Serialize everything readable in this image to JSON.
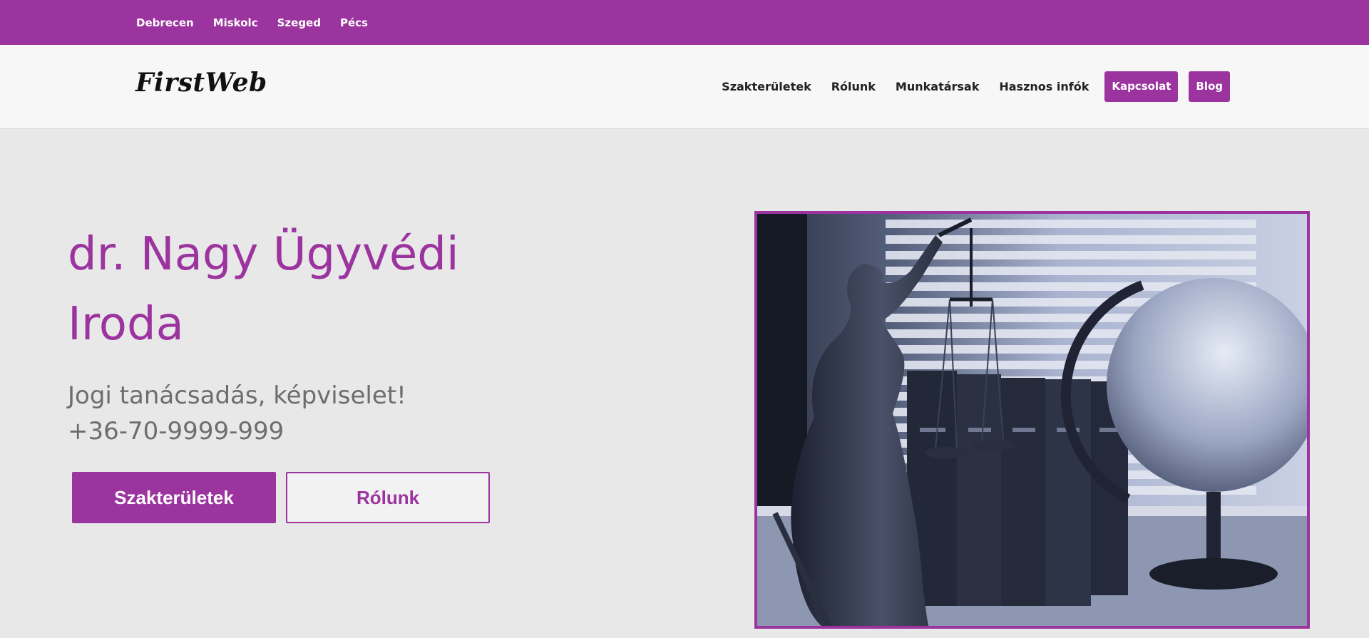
{
  "topbar": {
    "cities": [
      "Debrecen",
      "Miskolc",
      "Szeged",
      "Pécs"
    ]
  },
  "header": {
    "logo": "FirstWeb",
    "nav": {
      "szakteruletek": "Szakterületek",
      "rolunk": "Rólunk",
      "munkatarsak": "Munkatársak",
      "hasznos": "Hasznos infók",
      "kapcsolat": "Kapcsolat",
      "blog": "Blog"
    }
  },
  "hero": {
    "title_line1": "dr. Nagy Ügyvédi",
    "title_line2": "Iroda",
    "subtitle": "Jogi tanácsadás, képviselet!",
    "phone": "+36-70-9999-999",
    "primary_button": "Szakterületek",
    "secondary_button": "Rólunk"
  },
  "colors": {
    "brand": "#9c349f",
    "background": "#e9e8e9",
    "navbar": "#f7f7f7",
    "text_gray": "#6d6d6d"
  }
}
